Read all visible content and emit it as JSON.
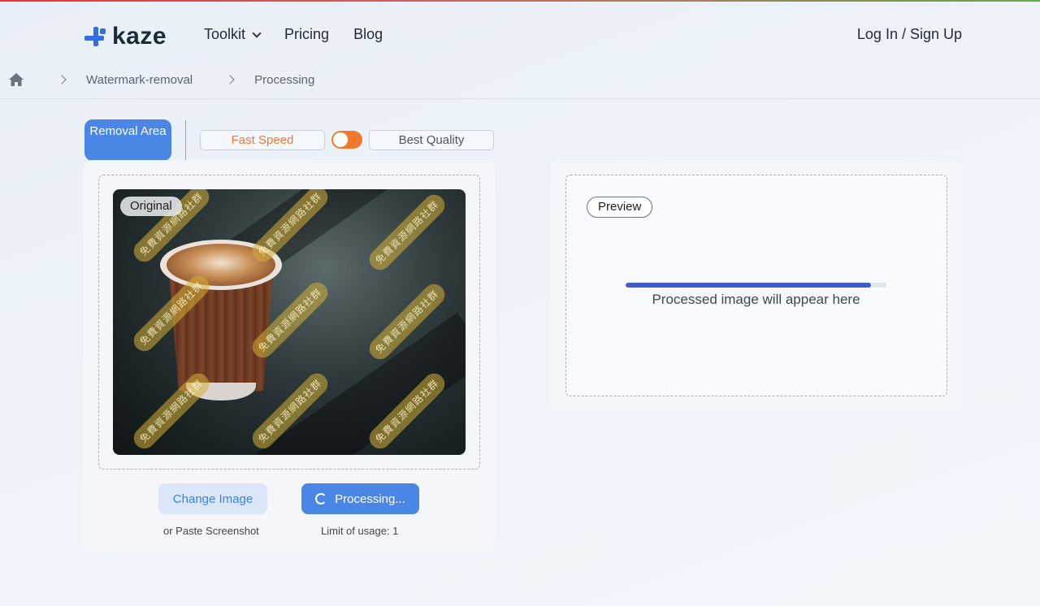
{
  "brand": {
    "name": "kaze",
    "color": "#2f6fe3"
  },
  "nav": {
    "toolkit": "Toolkit",
    "pricing": "Pricing",
    "blog": "Blog",
    "login": "Log In / Sign Up"
  },
  "breadcrumb": {
    "item1": "Watermark-removal",
    "item2": "Processing"
  },
  "toolbar": {
    "removal_area": "Removal Area",
    "fast_speed": "Fast Speed",
    "best_quality": "Best Quality",
    "toggle_on": true
  },
  "original_panel": {
    "tag": "Original",
    "watermark_text": "免費資源網路社群",
    "change_button": "Change Image",
    "paste_hint": "or Paste Screenshot",
    "processing_button": "Processing...",
    "usage_limit": "Limit of usage: 1"
  },
  "preview_panel": {
    "tag": "Preview",
    "progress": 0.94,
    "placeholder": "Processed image will appear here"
  },
  "colors": {
    "accent": "#4a86e6",
    "orange": "#f07a2e",
    "progress": "#3f5cc9"
  }
}
